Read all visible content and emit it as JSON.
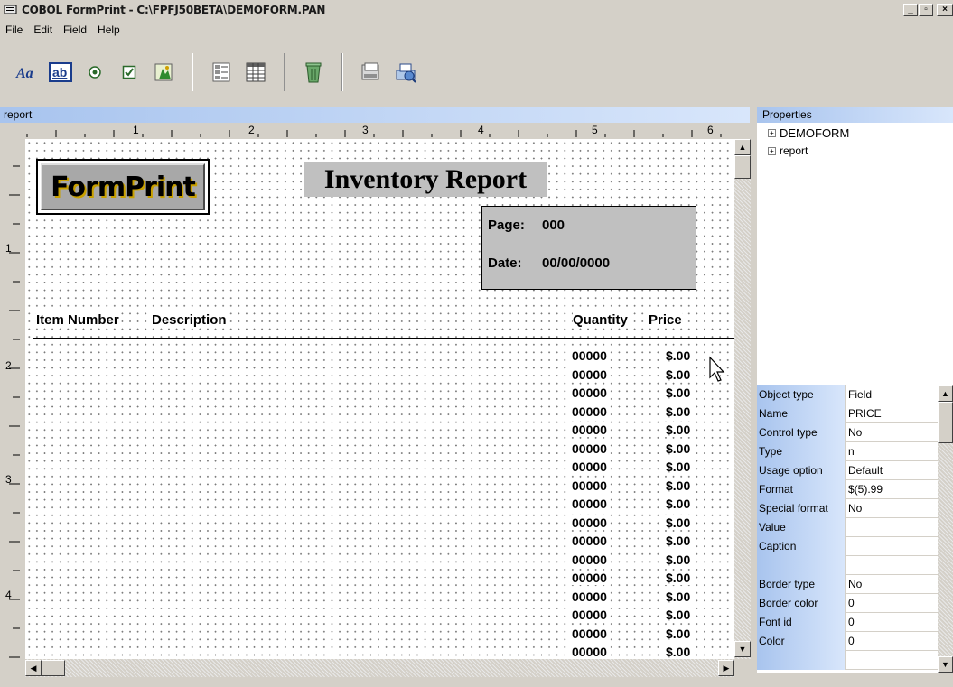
{
  "window": {
    "title": "COBOL FormPrint - C:\\FPFJ50BETA\\DEMOFORM.PAN"
  },
  "window_controls": {
    "minimize": "_",
    "maximize": "▫",
    "close": "×"
  },
  "menu": [
    "File",
    "Edit",
    "Field",
    "Help"
  ],
  "toolbar": {
    "items": [
      "text-tool-icon",
      "field-tool-icon",
      "radio-tool-icon",
      "checkbox-tool-icon",
      "image-tool-icon",
      "list-tool-icon",
      "table-tool-icon",
      "delete-tool-icon",
      "preview-tool-icon",
      "print-tool-icon"
    ]
  },
  "report_panel": {
    "title": "report"
  },
  "ruler": {
    "h_labels": [
      "1",
      "2",
      "3",
      "4",
      "5",
      "6"
    ],
    "v_labels": [
      "1",
      "2",
      "3",
      "4"
    ]
  },
  "form": {
    "logo_text": "FormPrint",
    "heading": "Inventory Report",
    "page_label": "Page:",
    "page_value": "000",
    "date_label": "Date:",
    "date_value": "00/00/0000",
    "columns": [
      "Item Number",
      "Description",
      "Quantity",
      "Price"
    ],
    "rows": [
      {
        "qty": "00000",
        "price": "$.00"
      },
      {
        "qty": "00000",
        "price": "$.00"
      },
      {
        "qty": "00000",
        "price": "$.00"
      },
      {
        "qty": "00000",
        "price": "$.00"
      },
      {
        "qty": "00000",
        "price": "$.00"
      },
      {
        "qty": "00000",
        "price": "$.00"
      },
      {
        "qty": "00000",
        "price": "$.00"
      },
      {
        "qty": "00000",
        "price": "$.00"
      },
      {
        "qty": "00000",
        "price": "$.00"
      },
      {
        "qty": "00000",
        "price": "$.00"
      },
      {
        "qty": "00000",
        "price": "$.00"
      },
      {
        "qty": "00000",
        "price": "$.00"
      },
      {
        "qty": "00000",
        "price": "$.00"
      },
      {
        "qty": "00000",
        "price": "$.00"
      },
      {
        "qty": "00000",
        "price": "$.00"
      },
      {
        "qty": "00000",
        "price": "$.00"
      },
      {
        "qty": "00000",
        "price": "$.00"
      }
    ]
  },
  "properties": {
    "title": "Properties",
    "tree": [
      "DEMOFORM",
      "report"
    ],
    "grid": [
      {
        "key": "Object type",
        "value": "Field"
      },
      {
        "key": "Name",
        "value": "PRICE"
      },
      {
        "key": "Control type",
        "value": "No"
      },
      {
        "key": "Type",
        "value": "n"
      },
      {
        "key": "Usage option",
        "value": "Default"
      },
      {
        "key": "Format",
        "value": "$(5).99"
      },
      {
        "key": "Special format",
        "value": "No"
      },
      {
        "key": "Value",
        "value": ""
      },
      {
        "key": "Caption",
        "value": ""
      },
      {
        "key": "",
        "value": ""
      },
      {
        "key": "Border type",
        "value": "No"
      },
      {
        "key": "Border color",
        "value": "0"
      },
      {
        "key": "Font id",
        "value": "0"
      },
      {
        "key": "Color",
        "value": "0"
      },
      {
        "key": "",
        "value": ""
      }
    ]
  }
}
